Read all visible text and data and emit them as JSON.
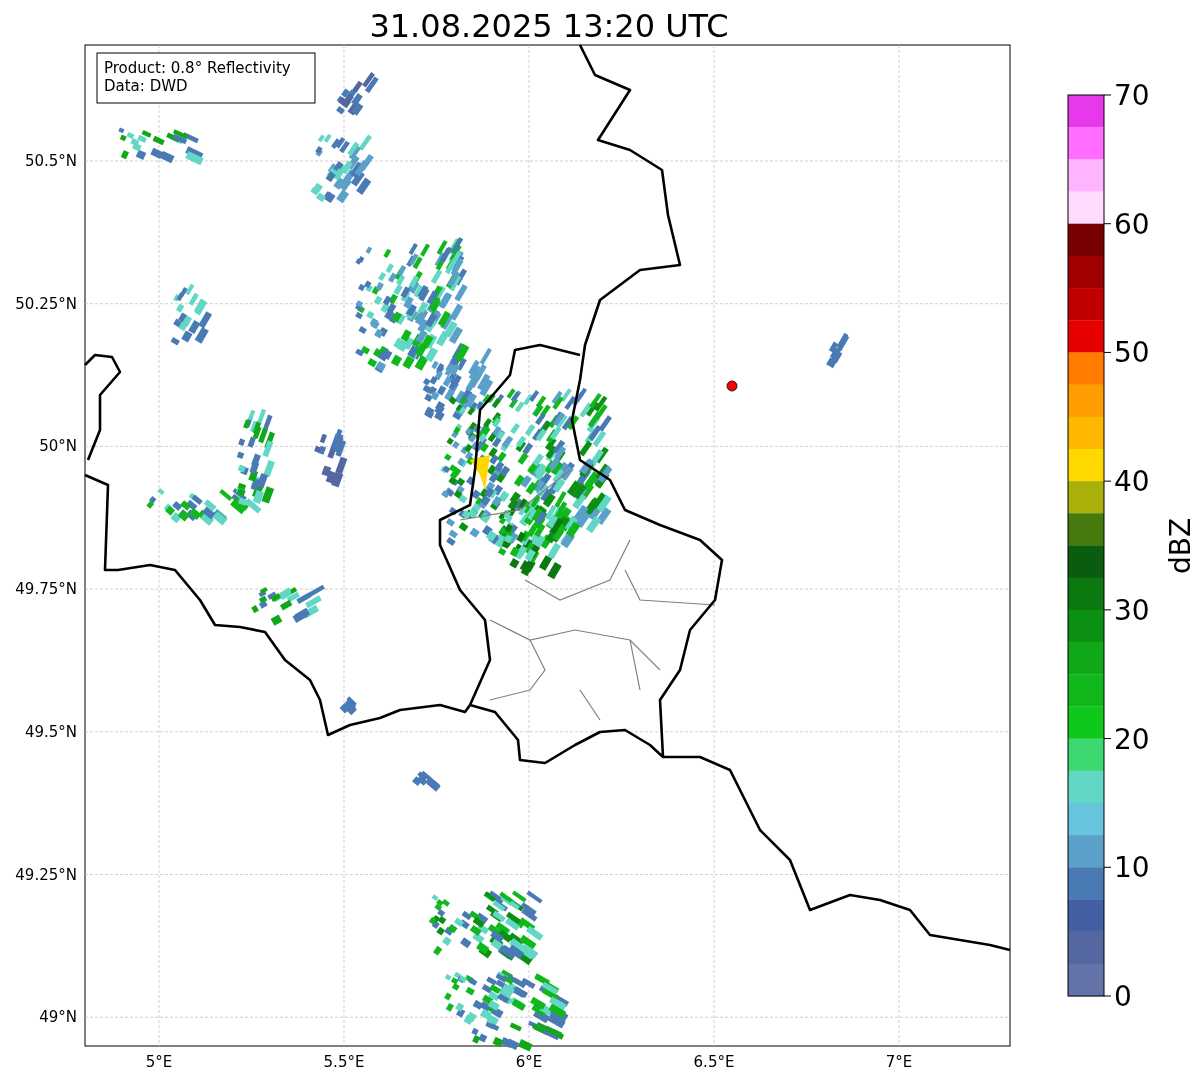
{
  "title": "31.08.2025 13:20 UTC",
  "info_box": [
    "Product: 0.8° Reflectivity",
    "Data: DWD"
  ],
  "map": {
    "x_ticks": [
      "5°E",
      "5.5°E",
      "6°E",
      "6.5°E",
      "7°E"
    ],
    "y_ticks": [
      "50.5°N",
      "50.25°N",
      "50°N",
      "49.75°N",
      "49.5°N",
      "49.25°N",
      "49°N"
    ]
  },
  "colorbar": {
    "label": "dBZ",
    "ticks": [
      "70",
      "60",
      "50",
      "40",
      "30",
      "20",
      "10",
      "0"
    ],
    "bins": [
      {
        "color": "#e838ec"
      },
      {
        "color": "#ff6cff"
      },
      {
        "color": "#ffb4ff"
      },
      {
        "color": "#ffdcff"
      },
      {
        "color": "#780000"
      },
      {
        "color": "#a00000"
      },
      {
        "color": "#c00000"
      },
      {
        "color": "#e60000"
      },
      {
        "color": "#ff7c00"
      },
      {
        "color": "#ff9c00"
      },
      {
        "color": "#ffb800"
      },
      {
        "color": "#ffd800"
      },
      {
        "color": "#aab00a"
      },
      {
        "color": "#467a0e"
      },
      {
        "color": "#0a5c0e"
      },
      {
        "color": "#0c7810"
      },
      {
        "color": "#0c9014"
      },
      {
        "color": "#10a818"
      },
      {
        "color": "#10b81c"
      },
      {
        "color": "#10c81c"
      },
      {
        "color": "#3cd870"
      },
      {
        "color": "#62d8c4"
      },
      {
        "color": "#66c4dc"
      },
      {
        "color": "#5aa0c8"
      },
      {
        "color": "#4a7ab4"
      },
      {
        "color": "#4360a4"
      },
      {
        "color": "#5567a0"
      },
      {
        "color": "#6474a8"
      }
    ]
  }
}
